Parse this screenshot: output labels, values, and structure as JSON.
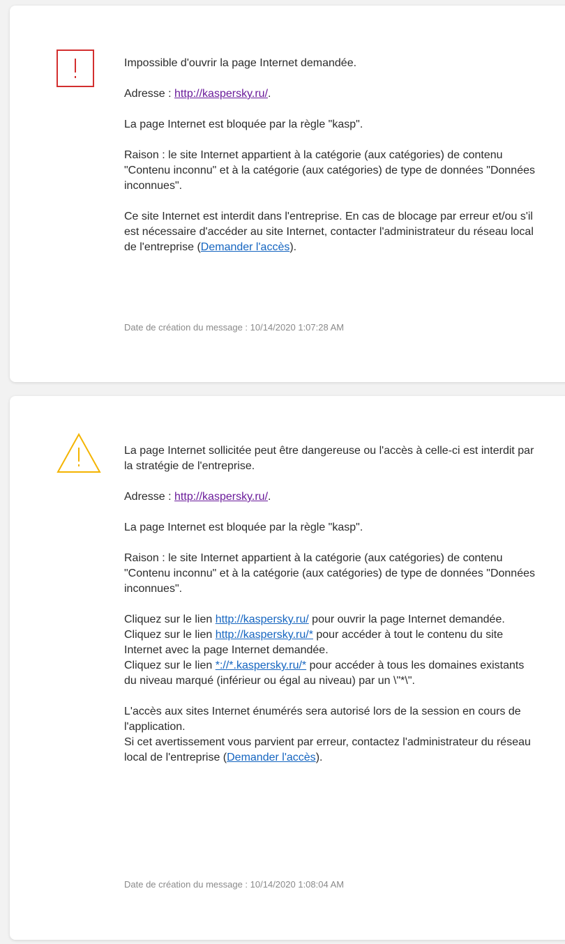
{
  "colors": {
    "error_icon": "#d32f2f",
    "warning_icon": "#f4b400",
    "link": "#1565c0",
    "visited_link": "#6a1b9a",
    "date_text": "#8a8a8a"
  },
  "blocked": {
    "icon": "exclamation-square-icon",
    "title": "Impossible d'ouvrir la page Internet demandée.",
    "address_label": "Adresse : ",
    "address_url": "http://kaspersky.ru/",
    "address_suffix": ".",
    "rule_text": "La page Internet est bloquée par la règle \"kasp\".",
    "reason_text": "Raison : le site Internet appartient à la catégorie (aux catégories) de contenu \"Contenu inconnu\" et à la catégorie (aux catégories) de type de données \"Données inconnues\".",
    "forbidden_text": "Ce site Internet est interdit dans l'entreprise. En cas de blocage par erreur et/ou s'il est nécessaire d'accéder au site Internet, contacter l'administrateur du réseau local de l'entreprise (",
    "request_access_link": "Demander l'accès",
    "forbidden_suffix": ").",
    "date_text": "Date de création du message : 10/14/2020 1:07:28 AM"
  },
  "warning": {
    "icon": "warning-triangle-icon",
    "title": "La page Internet sollicitée peut être dangereuse ou l'accès à celle-ci est interdit par la stratégie de l'entreprise.",
    "address_label": "Adresse : ",
    "address_url": "http://kaspersky.ru/",
    "address_suffix": ".",
    "rule_text": "La page Internet est bloquée par la règle \"kasp\".",
    "reason_text": "Raison : le site Internet appartient à la catégorie (aux catégories) de contenu \"Contenu inconnu\" et à la catégorie (aux catégories) de type de données \"Données inconnues\".",
    "click_prefix": "Cliquez sur le lien ",
    "link1_url": "http://kaspersky.ru/",
    "link1_suffix": " pour ouvrir la page Internet demandée.",
    "link2_url": "http://kaspersky.ru/*",
    "link2_suffix": " pour accéder à tout le contenu du site Internet avec la page Internet demandée.",
    "link3_url": "*://*.kaspersky.ru/*",
    "link3_suffix": " pour accéder à tous les domaines existants du niveau marqué (inférieur ou égal au niveau) par un \\\"*\\\".",
    "session_text": "L'accès aux sites Internet énumérés sera autorisé lors de la session en cours de l'application.",
    "error_text": "Si cet avertissement vous parvient par erreur, contactez l'administrateur du réseau local de l'entreprise (",
    "request_access_link": "Demander l'accès",
    "error_suffix": ").",
    "date_text": "Date de création du message : 10/14/2020 1:08:04 AM"
  }
}
